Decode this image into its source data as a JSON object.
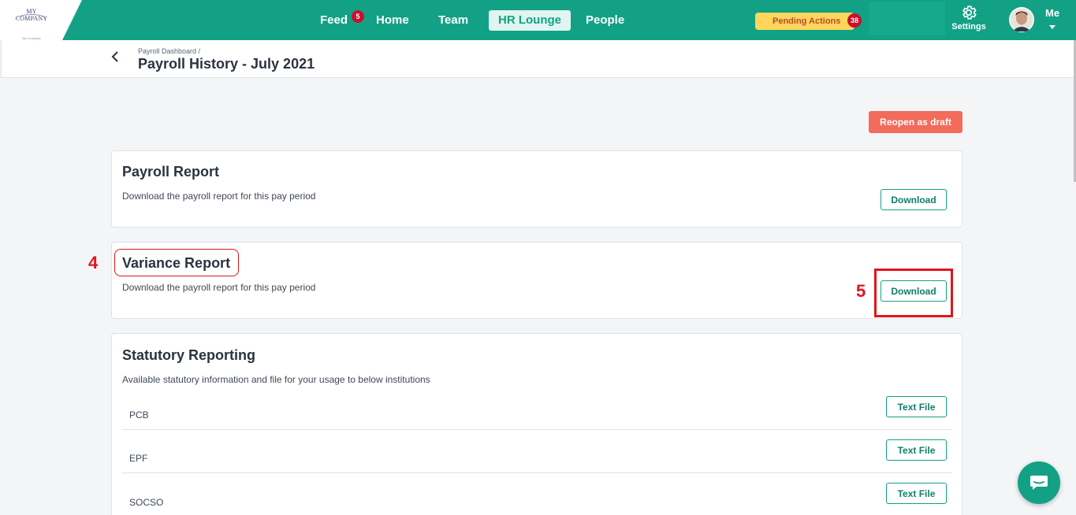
{
  "brand": {
    "name": "MY COMPANY",
    "tagline": "My Company"
  },
  "nav": {
    "items": [
      {
        "label": "Feed"
      },
      {
        "label": "Home"
      },
      {
        "label": "Team"
      },
      {
        "label": "HR Lounge",
        "active": true
      },
      {
        "label": "People"
      }
    ],
    "feed_badge": "5",
    "pending_label": "Pending Actions",
    "pending_badge": "38",
    "settings_label": "Settings",
    "user_label": "Me"
  },
  "header": {
    "breadcrumb": "Payroll Dashboard  /",
    "title": "Payroll History - July 2021"
  },
  "actions": {
    "reopen_label": "Reopen as draft"
  },
  "cards": {
    "payroll": {
      "title": "Payroll Report",
      "desc": "Download the payroll report for this pay period",
      "button": "Download"
    },
    "variance": {
      "title": "Variance Report",
      "desc": "Download the payroll report for this pay period",
      "button": "Download"
    },
    "statutory": {
      "title": "Statutory Reporting",
      "desc": "Available statutory information and file for your usage to below institutions",
      "rows": [
        {
          "label": "PCB",
          "button": "Text File"
        },
        {
          "label": "EPF",
          "button": "Text File"
        },
        {
          "label": "SOCSO",
          "button": "Text File"
        }
      ]
    }
  },
  "annotations": {
    "step4": "4",
    "step5": "5"
  },
  "colors": {
    "brand": "#13a185",
    "danger": "#f26b5b",
    "annotation": "#e0151b",
    "pending": "#fdd65b"
  }
}
